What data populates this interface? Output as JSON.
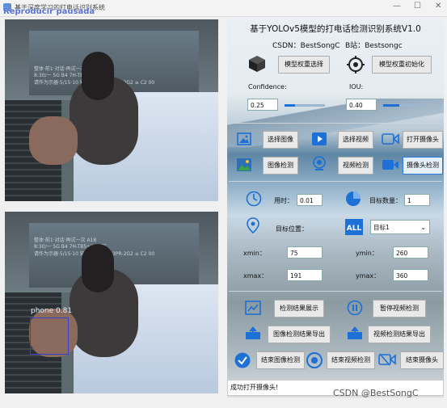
{
  "window": {
    "title": "基于深度学习的打电话识别系统",
    "minimize": "—",
    "maximize": "☐",
    "close": "✕"
  },
  "overlay": {
    "text": "Reproducir pausada"
  },
  "feed_overlay_lines": [
    "整体·前1·对话·再试一次 A18",
    "8:30/一 5G B4 7H-TB5+10 LTE",
    "请作为示器·5/15·10 知识发布 ≡ v83PR-2G2 ≡ C2 00"
  ],
  "detection": {
    "label": "phone",
    "score": "0.81"
  },
  "panel": {
    "title": "基于YOLOv5模型的打电话检测识别系统V1.0",
    "csdn_label": "CSDN：",
    "csdn_value": "BestSongC",
    "bili_label": "B站：",
    "bili_value": "Bestsongc",
    "btn_select_weights": "模型权重选择",
    "btn_init_weights": "模型权重初始化",
    "confidence_label": "Confidence:",
    "confidence_value": "0.25",
    "iou_label": "IOU:",
    "iou_value": "0.40",
    "confidence_level": 0.25,
    "iou_level": 0.4,
    "btn_select_image": "选择图像",
    "btn_select_video": "选择视频",
    "btn_open_camera": "打开摄像头",
    "btn_image_detect": "图像检测",
    "btn_video_detect": "视频检测",
    "btn_camera_detect": "摄像头检测",
    "time_label": "用时：",
    "time_value": "0.01",
    "count_label": "目标数量：",
    "count_value": "1",
    "pos_label": "目标位置：",
    "target_select": "目标1",
    "xmin_label": "xmin：",
    "xmin_value": "75",
    "ymin_label": "ymin：",
    "ymin_value": "260",
    "xmax_label": "xmax：",
    "xmax_value": "191",
    "ymax_label": "ymax：",
    "ymax_value": "360",
    "btn_show_results": "检测结果展示",
    "btn_pause_video": "暂停视频检测",
    "btn_export_image": "图像检测结果导出",
    "btn_export_video": "视频检测结果导出",
    "btn_end_image": "结束图像检测",
    "btn_end_video": "结束视频检测",
    "btn_end_camera": "结束摄像头"
  },
  "status": {
    "text": "成功打开摄像头!"
  },
  "watermark": {
    "text": "CSDN @BestSongC"
  },
  "colors": {
    "accent": "#1c70d6",
    "detect_box": "#3a3fd0",
    "overlay_text": "#5a73d8"
  }
}
